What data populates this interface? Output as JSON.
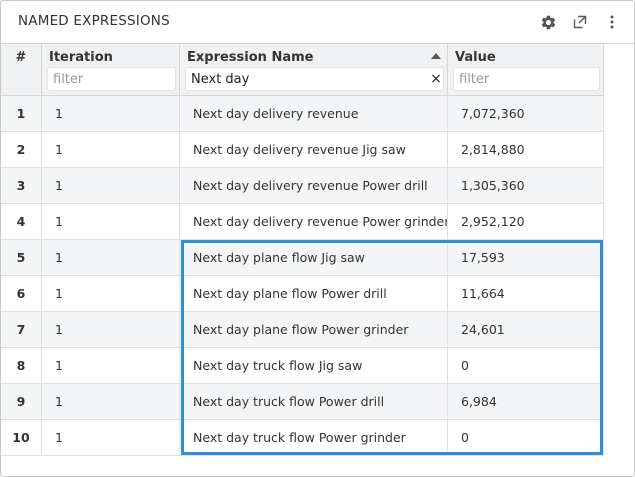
{
  "panel": {
    "title": "NAMED EXPRESSIONS",
    "icons": [
      "gear-icon",
      "popout-icon",
      "more-vertical-icon"
    ]
  },
  "columns": {
    "index_label": "#",
    "iteration_label": "Iteration",
    "expression_label": "Expression Name",
    "value_label": "Value",
    "iteration_filter": {
      "value": "",
      "placeholder": "filter"
    },
    "expression_filter": {
      "value": "Next day",
      "placeholder": "filter"
    },
    "value_filter": {
      "value": "",
      "placeholder": "filter"
    },
    "expression_sort": "ascending",
    "clear_glyph": "×"
  },
  "rows": [
    {
      "num": "1",
      "iteration": "1",
      "expression": "Next day delivery revenue",
      "value": "7,072,360"
    },
    {
      "num": "2",
      "iteration": "1",
      "expression": "Next day delivery revenue Jig saw",
      "value": "2,814,880"
    },
    {
      "num": "3",
      "iteration": "1",
      "expression": "Next day delivery revenue Power drill",
      "value": "1,305,360"
    },
    {
      "num": "4",
      "iteration": "1",
      "expression": "Next day delivery revenue Power grinder",
      "value": "2,952,120"
    },
    {
      "num": "5",
      "iteration": "1",
      "expression": "Next day plane flow Jig saw",
      "value": "17,593"
    },
    {
      "num": "6",
      "iteration": "1",
      "expression": "Next day plane flow Power drill",
      "value": "11,664"
    },
    {
      "num": "7",
      "iteration": "1",
      "expression": "Next day plane flow Power grinder",
      "value": "24,601"
    },
    {
      "num": "8",
      "iteration": "1",
      "expression": "Next day truck flow Jig saw",
      "value": "0"
    },
    {
      "num": "9",
      "iteration": "1",
      "expression": "Next day truck flow Power drill",
      "value": "6,984"
    },
    {
      "num": "10",
      "iteration": "1",
      "expression": "Next day truck flow Power grinder",
      "value": "0"
    }
  ],
  "colors": {
    "highlight": "#2f8fd4",
    "header_bg": "#f0f1f2",
    "alt_row_bg": "#f4f5f6"
  }
}
